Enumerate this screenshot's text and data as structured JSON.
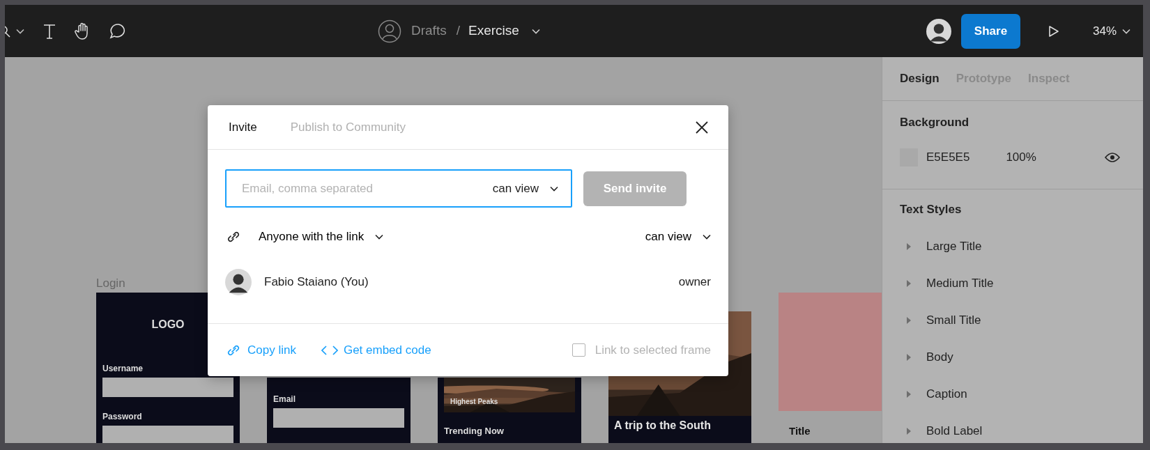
{
  "breadcrumb": {
    "folder": "Drafts",
    "separator": "/",
    "file": "Exercise"
  },
  "share_button": "Share",
  "zoom": "34%",
  "canvas": {
    "frames": [
      {
        "kind": "login",
        "label": "Login",
        "logo": "LOGO",
        "fields": [
          "Username",
          "Password"
        ]
      },
      {
        "kind": "form",
        "fields": [
          "Email"
        ]
      },
      {
        "kind": "feed",
        "caption": "Highest Peaks",
        "heading": "Trending Now"
      },
      {
        "kind": "article",
        "heading": "A trip to the South"
      },
      {
        "kind": "card",
        "heading": "Title"
      }
    ]
  },
  "dialog": {
    "tabs": [
      {
        "label": "Invite",
        "selected": true
      },
      {
        "label": "Publish to Community",
        "selected": false
      }
    ],
    "email_field": {
      "placeholder": "Email, comma separated",
      "permission": "can view"
    },
    "send_button": {
      "label": "Send invite",
      "disabled": true
    },
    "link_access": {
      "label": "Anyone with the link",
      "permission": "can view"
    },
    "members": [
      {
        "name": "Fabio Staiano (You)",
        "role": "owner"
      }
    ],
    "footer": {
      "copy_link": "Copy link",
      "embed_code": "Get embed code",
      "frame_option": {
        "label": "Link to selected frame",
        "checked": false
      }
    }
  },
  "panel": {
    "tabs": [
      {
        "label": "Design",
        "selected": true
      },
      {
        "label": "Prototype",
        "selected": false
      },
      {
        "label": "Inspect",
        "selected": false
      }
    ],
    "background": {
      "title": "Background",
      "hex": "E5E5E5",
      "opacity": "100%"
    },
    "text_styles": {
      "title": "Text Styles",
      "items": [
        "Large Title",
        "Medium Title",
        "Small Title",
        "Body",
        "Caption",
        "Bold Label"
      ]
    }
  }
}
